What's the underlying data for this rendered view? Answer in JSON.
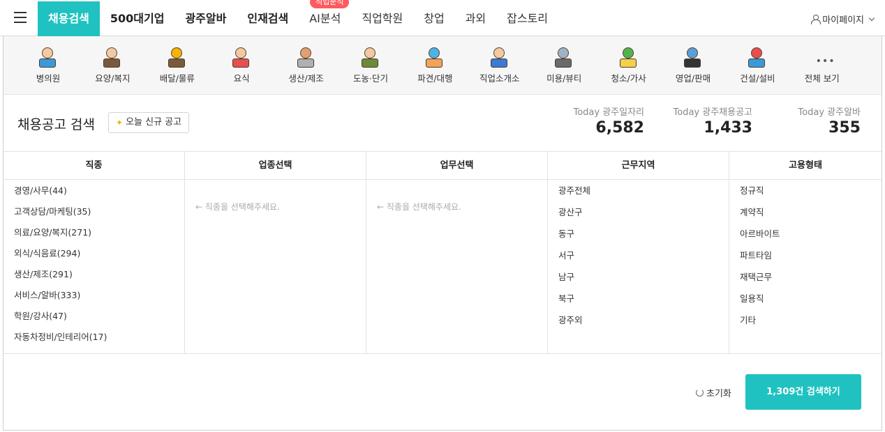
{
  "nav": {
    "items": [
      {
        "label": "채용검색",
        "style": "active"
      },
      {
        "label": "500대기업",
        "style": "bold"
      },
      {
        "label": "광주알바",
        "style": "bold"
      },
      {
        "label": "인재검색",
        "style": "bold"
      },
      {
        "label": "AI분석",
        "style": "normal"
      },
      {
        "label": "직업학원",
        "style": "normal"
      },
      {
        "label": "창업",
        "style": "normal"
      },
      {
        "label": "과외",
        "style": "normal"
      },
      {
        "label": "잡스토리",
        "style": "normal"
      }
    ],
    "badge": "직업분석",
    "mypage": "마이페이지"
  },
  "categories": [
    {
      "label": "병의원",
      "icon": "doctor-icon"
    },
    {
      "label": "요양/복지",
      "icon": "caregiver-icon"
    },
    {
      "label": "배달/물류",
      "icon": "delivery-icon"
    },
    {
      "label": "요식",
      "icon": "chef-icon"
    },
    {
      "label": "생산/제조",
      "icon": "factory-icon"
    },
    {
      "label": "도농·단기",
      "icon": "farmer-icon"
    },
    {
      "label": "파견/대행",
      "icon": "handshake-icon"
    },
    {
      "label": "직업소개소",
      "icon": "agency-icon"
    },
    {
      "label": "미용/뷰티",
      "icon": "beauty-icon"
    },
    {
      "label": "청소/가사",
      "icon": "cleaning-icon"
    },
    {
      "label": "영업/판매",
      "icon": "sales-icon"
    },
    {
      "label": "건설/설비",
      "icon": "construction-icon"
    },
    {
      "label": "전체 보기",
      "icon": "more-icon"
    }
  ],
  "search": {
    "title": "채용공고 검색",
    "new_button": "오늘 신규 공고",
    "stats": [
      {
        "label": "Today 광주일자리",
        "value": "6,582"
      },
      {
        "label": "Today 광주채용공고",
        "value": "1,433"
      },
      {
        "label": "Today 광주알바",
        "value": "355"
      }
    ]
  },
  "filters": {
    "job": {
      "header": "직종",
      "items": [
        "경영/사무(44)",
        "고객상담/마케팅(35)",
        "의료/요양/복지(271)",
        "외식/식음료(294)",
        "생산/제조(291)",
        "서비스/알바(333)",
        "학원/강사(47)",
        "자동차정비/인테리어(17)"
      ]
    },
    "industry": {
      "header": "업종선택",
      "hint": "← 직종을 선택해주세요."
    },
    "task": {
      "header": "업무선택",
      "hint": "← 직종을 선택해주세요."
    },
    "region": {
      "header": "근무지역",
      "items": [
        "광주전체",
        "광산구",
        "동구",
        "서구",
        "남구",
        "북구",
        "광주외"
      ]
    },
    "employment": {
      "header": "고용형태",
      "items": [
        "정규직",
        "계약직",
        "아르바이트",
        "파트타임",
        "재택근무",
        "일용직",
        "기타"
      ]
    }
  },
  "footer": {
    "reset": "초기화",
    "search_button": "1,309건 검색하기"
  }
}
